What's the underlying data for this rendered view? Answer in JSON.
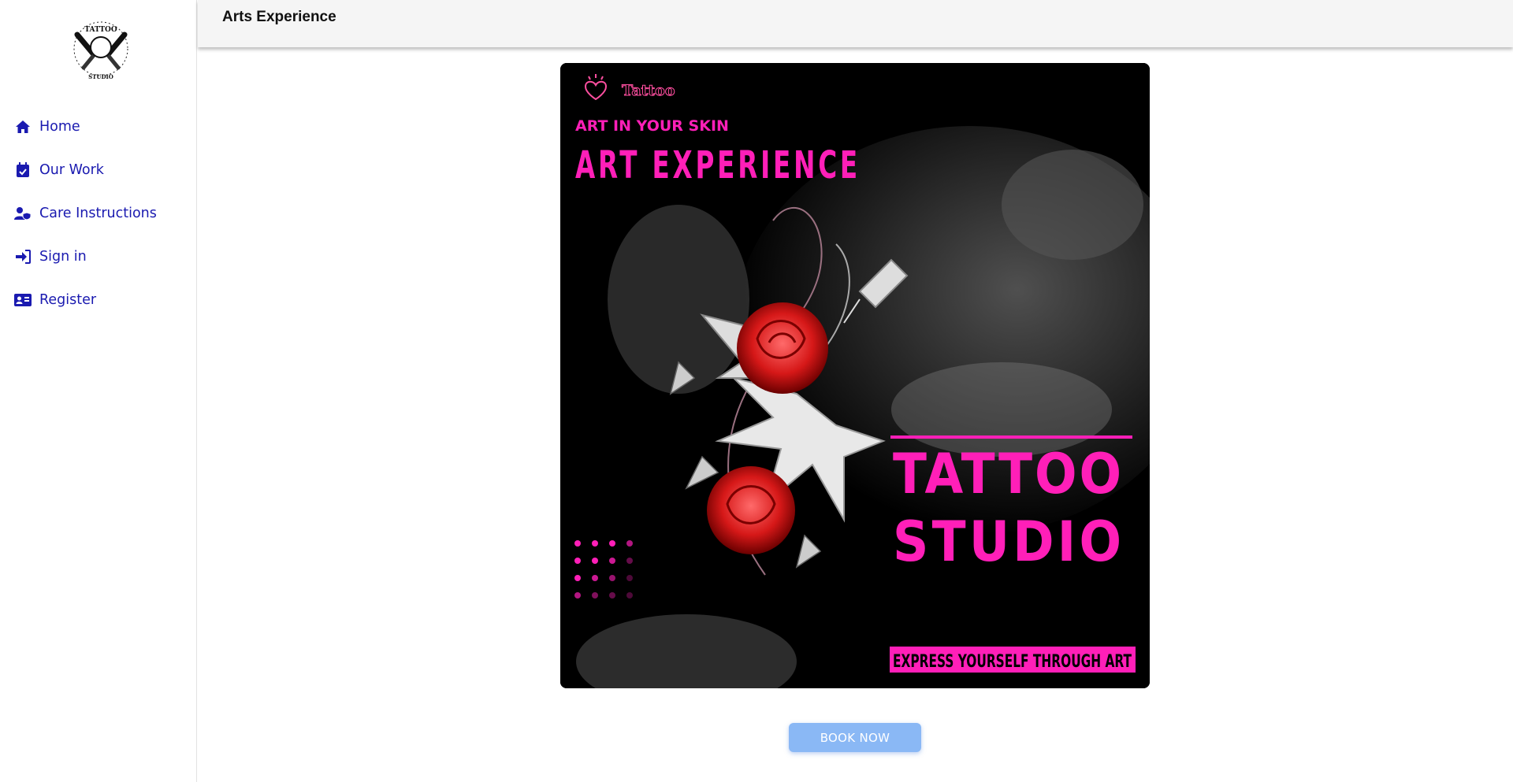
{
  "sidebar": {
    "logo_text_top": "TATTOO",
    "logo_text_bottom": "STUDIO",
    "items": [
      {
        "label": "Home",
        "icon": "home-icon"
      },
      {
        "label": "Our Work",
        "icon": "calendar-check-icon"
      },
      {
        "label": "Care Instructions",
        "icon": "user-shield-icon"
      },
      {
        "label": "Sign in",
        "icon": "sign-in-icon"
      },
      {
        "label": "Register",
        "icon": "id-card-icon"
      }
    ]
  },
  "header": {
    "title": "Arts Experience"
  },
  "poster": {
    "brand": "Tattoo",
    "tagline": "ART IN YOUR SKIN",
    "headline": "ART EXPERIENCE",
    "line1": "TATTOO",
    "line2": "STUDIO",
    "footer": "EXPRESS YOURSELF THROUGH   ART",
    "accent": "#ff1fb8"
  },
  "actions": {
    "book_label": "BOOK NOW"
  },
  "colors": {
    "nav_text": "#1a1ab0",
    "button": "#8ab8f5"
  }
}
